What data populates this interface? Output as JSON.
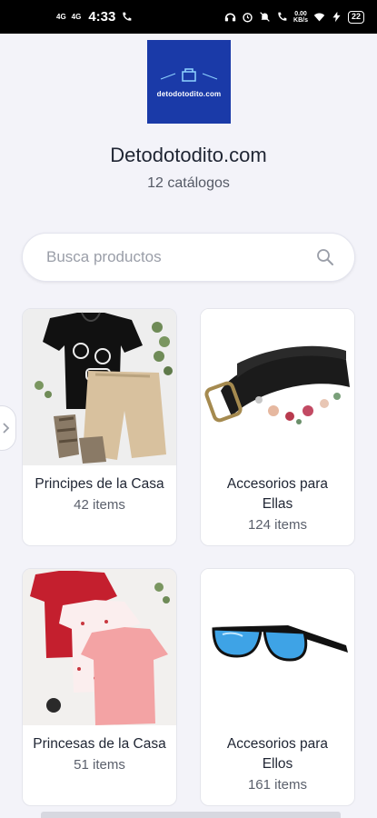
{
  "status_bar": {
    "net1": "4G",
    "net2": "4G",
    "time": "4:33",
    "speed_top": "0.00",
    "speed_bottom": "KB/s",
    "battery": "22"
  },
  "logo": {
    "text": "detodotodito.com",
    "color": "#1a3aa8"
  },
  "shop": {
    "title": "Detodotodito.com",
    "subtitle": "12 catálogos"
  },
  "search": {
    "placeholder": "Busca productos",
    "icon": "search-icon"
  },
  "catalogs": [
    {
      "name": "Principes de la Casa",
      "count": "42 items",
      "image": "boys-clothes-image"
    },
    {
      "name": "Accesorios para Ellas",
      "count": "124 items",
      "image": "belt-image"
    },
    {
      "name": "Princesas de la Casa",
      "count": "51 items",
      "image": "girls-tops-image"
    },
    {
      "name": "Accesorios para Ellos",
      "count": "161 items",
      "image": "sunglasses-image"
    }
  ]
}
